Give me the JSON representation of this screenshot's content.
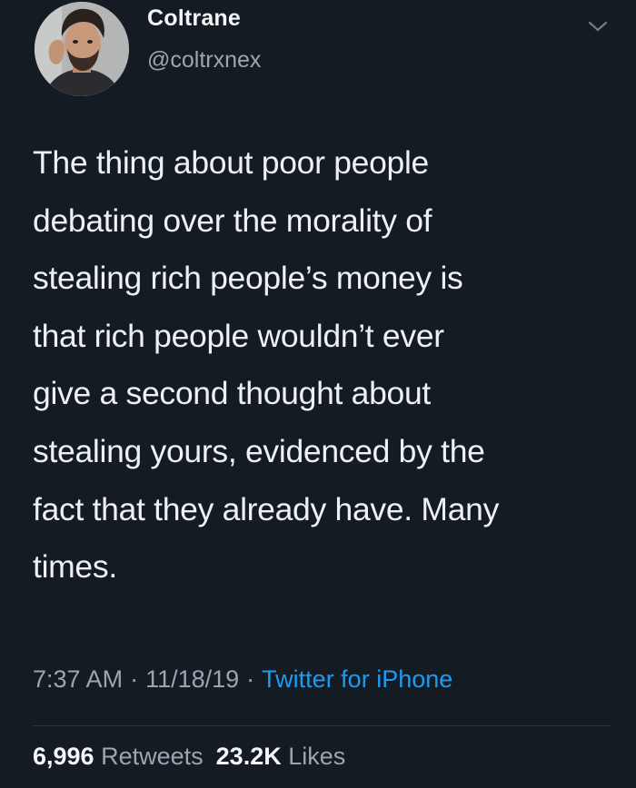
{
  "tweet": {
    "author": {
      "display_name": "Coltrane",
      "handle": "@coltrxnex"
    },
    "menu_icon": "chevron-down-icon",
    "text_lines": [
      "The thing about poor people",
      "debating over the morality of",
      "stealing rich people’s money is",
      "that rich people wouldn’t ever",
      "give a second thought about",
      "stealing yours, evidenced by the",
      "fact that they already have. Many",
      "times."
    ],
    "meta": {
      "time": "7:37 AM",
      "separator": "·",
      "date": "11/18/19",
      "source": "Twitter for iPhone"
    },
    "stats": {
      "retweets_count": "6,996",
      "retweets_label": "Retweets",
      "likes_count": "23.2K",
      "likes_label": "Likes"
    },
    "colors": {
      "background": "#141b23",
      "link": "#1d9bf0",
      "secondary_text": "#9aa6b0"
    }
  }
}
